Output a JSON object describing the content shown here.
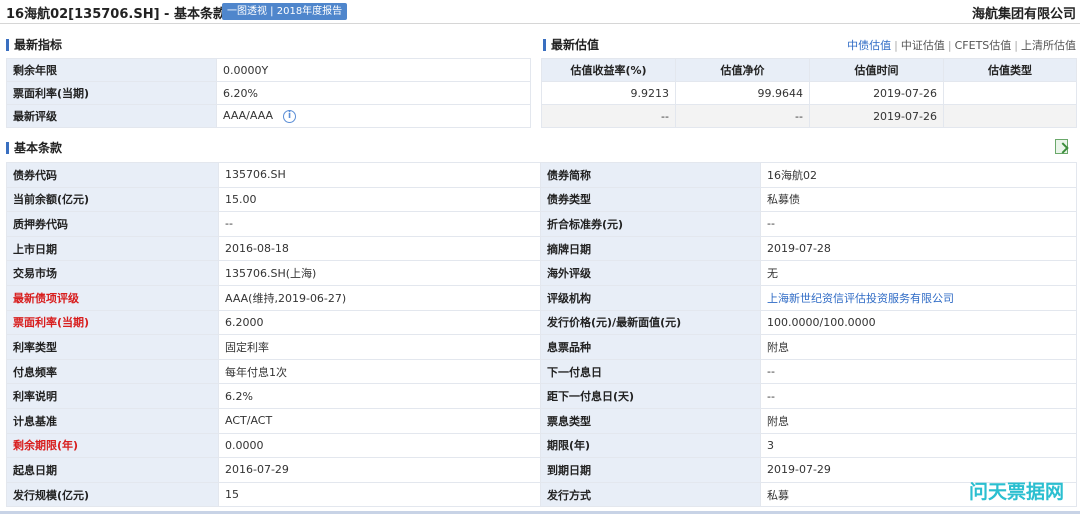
{
  "header": {
    "title": "16海航02[135706.SH] - 基本条款",
    "badges": "一图透视 | 2018年度报告",
    "company": "海航集团有限公司"
  },
  "latest": {
    "heading": "最新指标",
    "rows": [
      {
        "label": "剩余年限",
        "value": "0.0000Y"
      },
      {
        "label": "票面利率(当期)",
        "value": "6.20%"
      },
      {
        "label": "最新评级",
        "value": "AAA/AAA"
      }
    ],
    "info_glyph": "i"
  },
  "valuation": {
    "heading": "最新估值",
    "sources": [
      "中债估值",
      "中证估值",
      "CFETS估值",
      "上清所估值"
    ],
    "sep": "|",
    "columns": [
      "估值收益率(%)",
      "估值净价",
      "估值时间",
      "估值类型"
    ],
    "rows": [
      [
        "9.9213",
        "99.9644",
        "2019-07-26",
        ""
      ],
      [
        "--",
        "--",
        "2019-07-26",
        ""
      ]
    ]
  },
  "basic": {
    "heading": "基本条款",
    "rows": [
      {
        "k1": "债券代码",
        "v1": "135706.SH",
        "k2": "债券简称",
        "v2": "16海航02"
      },
      {
        "k1": "当前余额(亿元)",
        "v1": "15.00",
        "k2": "债券类型",
        "v2": "私募债"
      },
      {
        "k1": "质押券代码",
        "v1": "--",
        "k2": "折合标准券(元)",
        "v2": "--"
      },
      {
        "k1": "上市日期",
        "v1": "2016-08-18",
        "k2": "摘牌日期",
        "v2": "2019-07-28"
      },
      {
        "k1": "交易市场",
        "v1": "135706.SH(上海)",
        "k2": "海外评级",
        "v2": "无"
      },
      {
        "k1": "最新债项评级",
        "v1": "AAA(维持,2019-06-27)",
        "k2": "评级机构",
        "v2": "上海新世纪资信评估投资服务有限公司"
      },
      {
        "k1": "票面利率(当期)",
        "v1": "6.2000",
        "k2": "发行价格(元)/最新面值(元)",
        "v2": "100.0000/100.0000"
      },
      {
        "k1": "利率类型",
        "v1": "固定利率",
        "k2": "息票品种",
        "v2": "附息"
      },
      {
        "k1": "付息频率",
        "v1": "每年付息1次",
        "k2": "下一付息日",
        "v2": "--"
      },
      {
        "k1": "利率说明",
        "v1": "6.2%",
        "k2": "距下一付息日(天)",
        "v2": "--"
      },
      {
        "k1": "计息基准",
        "v1": "ACT/ACT",
        "k2": "票息类型",
        "v2": "附息"
      },
      {
        "k1": "剩余期限(年)",
        "v1": "0.0000",
        "k2": "期限(年)",
        "v2": "3"
      },
      {
        "k1": "起息日期",
        "v1": "2016-07-29",
        "k2": "到期日期",
        "v2": "2019-07-29"
      },
      {
        "k1": "发行规模(亿元)",
        "v1": "15",
        "k2": "发行方式",
        "v2": "私募"
      }
    ]
  },
  "watermark": "问天票据网",
  "colors": {
    "accent": "#3a6fc0",
    "label_bg": "#e8eef7",
    "highlight_red": "#d81e1e",
    "link_blue": "#2f6bc5"
  }
}
